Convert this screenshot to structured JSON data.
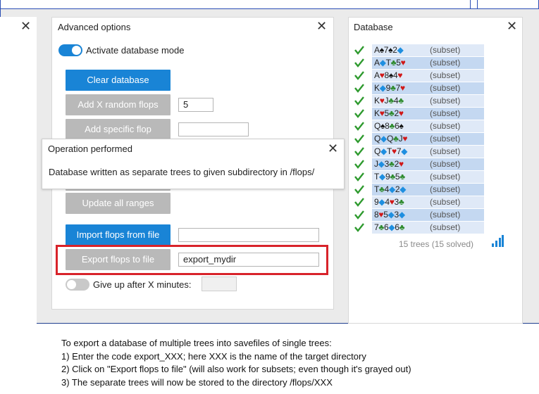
{
  "advanced": {
    "title": "Advanced options",
    "toggle_label": "Activate database mode",
    "clear_btn": "Clear database",
    "add_random_btn": "Add X random flops",
    "add_random_value": "5",
    "add_specific_btn": "Add specific flop",
    "add_specific_value": "",
    "update_btn": "Update all ranges",
    "import_btn": "Import flops from file",
    "import_value": "",
    "export_btn": "Export flops to file",
    "export_value": "export_mydir",
    "giveup_label": "Give up after X minutes:",
    "giveup_value": ""
  },
  "dialog": {
    "title": "Operation performed",
    "message": "Database written as separate trees to given subdirectory in /flops/"
  },
  "database": {
    "title": "Database",
    "subset_label": "(subset)",
    "rows": [
      {
        "cards": [
          [
            "A",
            "s"
          ],
          [
            "7",
            "s"
          ],
          [
            "2",
            "d"
          ]
        ]
      },
      {
        "cards": [
          [
            "A",
            "d"
          ],
          [
            "T",
            "c"
          ],
          [
            "5",
            "h"
          ]
        ]
      },
      {
        "cards": [
          [
            "A",
            "h"
          ],
          [
            "8",
            "s"
          ],
          [
            "4",
            "h"
          ]
        ]
      },
      {
        "cards": [
          [
            "K",
            "d"
          ],
          [
            "9",
            "c"
          ],
          [
            "7",
            "h"
          ]
        ]
      },
      {
        "cards": [
          [
            "K",
            "h"
          ],
          [
            "J",
            "c"
          ],
          [
            "4",
            "c"
          ]
        ]
      },
      {
        "cards": [
          [
            "K",
            "h"
          ],
          [
            "5",
            "c"
          ],
          [
            "2",
            "h"
          ]
        ]
      },
      {
        "cards": [
          [
            "Q",
            "s"
          ],
          [
            "8",
            "c"
          ],
          [
            "6",
            "s"
          ]
        ]
      },
      {
        "cards": [
          [
            "Q",
            "d"
          ],
          [
            "Q",
            "c"
          ],
          [
            "J",
            "h"
          ]
        ]
      },
      {
        "cards": [
          [
            "Q",
            "d"
          ],
          [
            "T",
            "h"
          ],
          [
            "7",
            "d"
          ]
        ]
      },
      {
        "cards": [
          [
            "J",
            "d"
          ],
          [
            "3",
            "c"
          ],
          [
            "2",
            "h"
          ]
        ]
      },
      {
        "cards": [
          [
            "T",
            "d"
          ],
          [
            "9",
            "c"
          ],
          [
            "5",
            "c"
          ]
        ]
      },
      {
        "cards": [
          [
            "T",
            "c"
          ],
          [
            "4",
            "d"
          ],
          [
            "2",
            "d"
          ]
        ]
      },
      {
        "cards": [
          [
            "9",
            "d"
          ],
          [
            "4",
            "h"
          ],
          [
            "3",
            "c"
          ]
        ]
      },
      {
        "cards": [
          [
            "8",
            "h"
          ],
          [
            "5",
            "d"
          ],
          [
            "3",
            "d"
          ]
        ]
      },
      {
        "cards": [
          [
            "7",
            "c"
          ],
          [
            "6",
            "d"
          ],
          [
            "6",
            "c"
          ]
        ]
      }
    ],
    "footer": "15 trees (15 solved)"
  },
  "suit_glyphs": {
    "s": "♠",
    "c": "♣",
    "d": "◆",
    "h": "♥"
  },
  "colors": {
    "accent": "#1984d6",
    "highlight": "#d8232a",
    "check": "#2e9a2e"
  },
  "caption": {
    "line1": "To export a database of multiple trees into savefiles of single trees:",
    "line2": "1) Enter the code export_XXX; here XXX is the name of the target directory",
    "line3": "2) Click on \"Export flops to file\" (will also work for subsets; even though it's grayed out)",
    "line4": "3) The separate trees will now be stored to the directory /flops/XXX"
  }
}
